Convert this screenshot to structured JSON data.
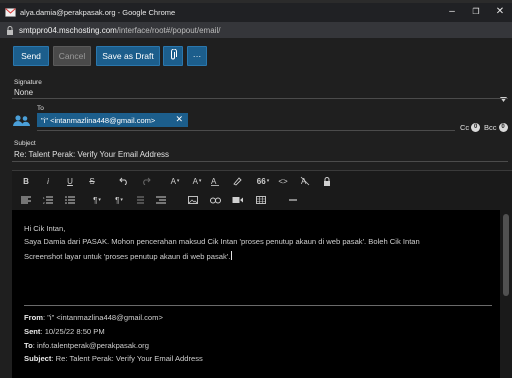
{
  "window": {
    "title": "alya.damia@perakpasak.org - Google Chrome",
    "minimize_glyph": "–",
    "restore_glyph": "❐",
    "close_glyph": "✕"
  },
  "address": {
    "host": "smtppro04.mschosting.com",
    "path": "/interface/root#/popout/email/"
  },
  "toolbar": {
    "send": "Send",
    "cancel": "Cancel",
    "save_draft": "Save as Draft",
    "attach_icon": "paperclip-icon",
    "more": "···"
  },
  "signature": {
    "label": "Signature",
    "value": "None"
  },
  "to": {
    "label": "To",
    "recipient": "\"i\" <intanmazlina448@gmail.com>",
    "remove": "✕",
    "cc_label": "Cc",
    "cc_count": "0",
    "bcc_label": "Bcc",
    "bcc_count": "0"
  },
  "subject": {
    "label": "Subject",
    "value": "Re: Talent Perak: Verify Your Email Address"
  },
  "format": {
    "bold": "B",
    "italic": "i",
    "underline": "U",
    "strike": "S",
    "font_size": "A",
    "font_color": "A",
    "quote": "66",
    "code": "<>",
    "clear_format": "A",
    "align": "¶",
    "ltr": "¶"
  },
  "body": {
    "greeting": "Hi Cik Intan,",
    "line1": "Saya Damia dari PASAK. Mohon pencerahan maksud Cik Intan 'proses penutup akaun di web pasak'. Boleh Cik Intan",
    "line2": "Screenshot layar untuk 'proses penutup akaun di web pasak'."
  },
  "quoted": {
    "from_label": "From",
    "from": "\"i\" <intanmazlina448@gmail.com>",
    "sent_label": "Sent",
    "sent": "10/25/22 8:50 PM",
    "to_label": "To",
    "to": "info.talentperak@perakpasak.org",
    "subject_label": "Subject",
    "subject": "Re: Talent Perak: Verify Your Email Address"
  },
  "colors": {
    "primary": "#1c5e8c",
    "background": "#1f1f1f",
    "editor": "#000000"
  }
}
